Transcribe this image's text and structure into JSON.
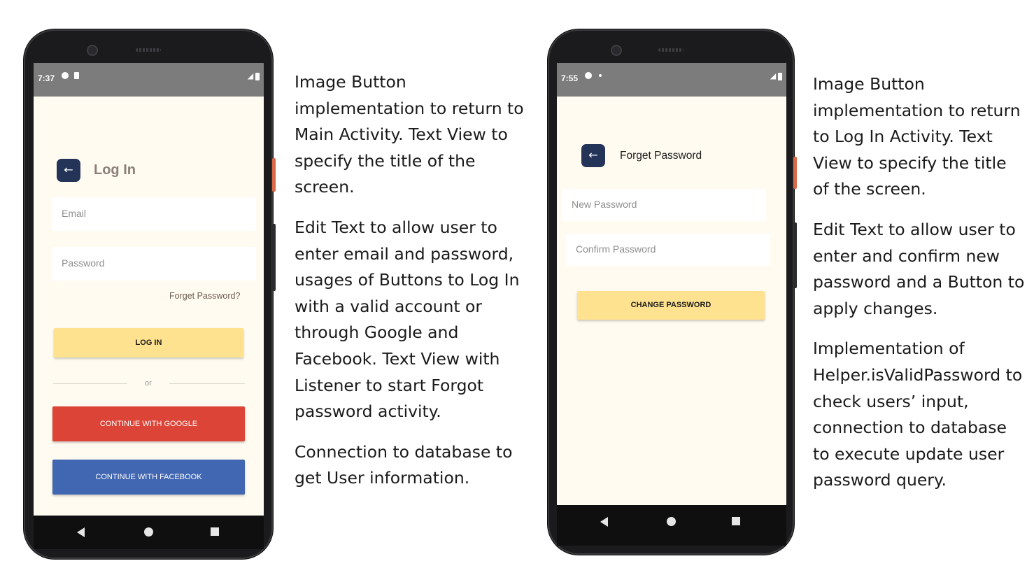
{
  "left_phone": {
    "status": {
      "time": "7:37"
    },
    "header": {
      "back_icon": "arrow-left-icon",
      "back_glyph": "←",
      "title": "Log In"
    },
    "email_placeholder": "Email",
    "password_placeholder": "Password",
    "forgot_link": "Forget Password?",
    "login_button": "LOG IN",
    "divider_text": "or",
    "google_button": "CONTINUE WITH GOOGLE",
    "facebook_button": "CONTINUE WITH FACEBOOK"
  },
  "right_phone": {
    "status": {
      "time": "7:55"
    },
    "header": {
      "back_icon": "arrow-left-icon",
      "back_glyph": "←",
      "title": "Forget Password"
    },
    "new_password_placeholder": "New Password",
    "confirm_password_placeholder": "Confirm Password",
    "change_button": "CHANGE PASSWORD"
  },
  "left_description": {
    "paragraphs": [
      "Image Button implementation to return to Main Activity. Text View to specify the title of the screen.",
      "Edit Text to allow user to enter email and password, usages of Buttons to Log In with a valid account or through Google and Facebook. Text View with Listener to start Forgot password activity.",
      "Connection to database to get User information."
    ]
  },
  "right_description": {
    "paragraphs": [
      "Image Button implementation to return to Log In Activity. Text View to specify the title of the screen.",
      "Edit Text to allow user to enter and confirm new password and a Button to apply changes.",
      "Implementation of Helper.isValidPassword to check users’ input, connection to database to execute update user password query."
    ]
  },
  "colors": {
    "screen_bg": "#fffbf0",
    "status_bar": "#7c7c7c",
    "back_button": "#243358",
    "primary_button": "#ffe28f",
    "google": "#db4437",
    "facebook": "#4267b2"
  }
}
